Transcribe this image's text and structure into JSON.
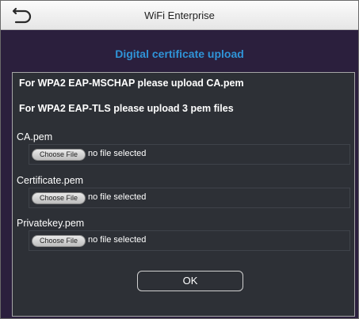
{
  "window": {
    "title": "WiFi Enterprise",
    "back_icon": "back-arrow-icon"
  },
  "section_title": "Digital certificate upload",
  "notes": {
    "mschap": "For WPA2 EAP-MSCHAP please upload CA.pem",
    "tls": "For WPA2 EAP-TLS please upload 3 pem files"
  },
  "fields": [
    {
      "label": "CA.pem",
      "button_label": "Choose File",
      "status": "no file selected"
    },
    {
      "label": "Certificate.pem",
      "button_label": "Choose File",
      "status": "no file selected"
    },
    {
      "label": "Privatekey.pem",
      "button_label": "Choose File",
      "status": "no file selected"
    }
  ],
  "ok_label": "OK",
  "colors": {
    "accent": "#2f94d8",
    "background": "#2b1f3d",
    "panel": "#2d3036"
  }
}
